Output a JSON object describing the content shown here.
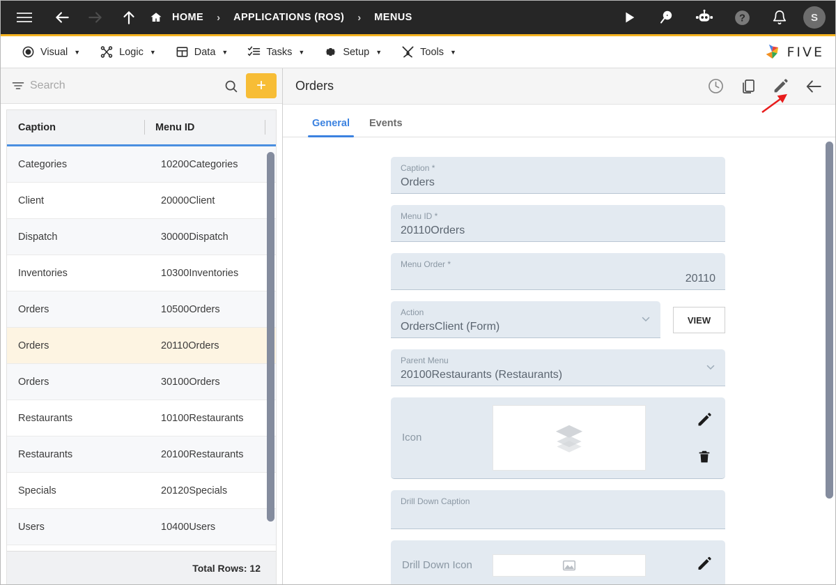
{
  "topbar": {
    "menu_icon": "hamburger-icon",
    "back_label": "back-arrow-icon",
    "forward_label": "forward-arrow-icon",
    "up_label": "up-arrow-icon",
    "breadcrumbs": [
      {
        "label": "HOME",
        "icon": "home-icon"
      },
      {
        "label": "APPLICATIONS (ROS)",
        "icon": ""
      },
      {
        "label": "MENUS",
        "icon": ""
      }
    ],
    "separator": "›",
    "actions": [
      {
        "name": "run-icon"
      },
      {
        "name": "search-play-icon"
      },
      {
        "name": "robot-icon"
      },
      {
        "name": "help-icon"
      },
      {
        "name": "notifications-bell-icon"
      }
    ],
    "avatar_initial": "S",
    "background": "#262626"
  },
  "menubar": {
    "accent_color": "#f5b421",
    "items": [
      {
        "label": "Visual",
        "icon": "eye-icon"
      },
      {
        "label": "Logic",
        "icon": "flow-icon"
      },
      {
        "label": "Data",
        "icon": "table-icon"
      },
      {
        "label": "Tasks",
        "icon": "checklist-icon"
      },
      {
        "label": "Setup",
        "icon": "gear-icon"
      },
      {
        "label": "Tools",
        "icon": "tools-icon"
      }
    ],
    "caret": "▼",
    "logo_text": "FIVE"
  },
  "sidebar": {
    "search": {
      "placeholder": "Search",
      "value": ""
    },
    "filter_icon": "filter-icon",
    "search_icon": "search-icon",
    "add_label": "+",
    "add_color": "#f7bd36",
    "columns": [
      "Caption",
      "Menu ID"
    ],
    "rows": [
      {
        "caption": "Categories",
        "menu_id": "10200Categories",
        "selected": false
      },
      {
        "caption": "Client",
        "menu_id": "20000Client",
        "selected": false
      },
      {
        "caption": "Dispatch",
        "menu_id": "30000Dispatch",
        "selected": false
      },
      {
        "caption": "Inventories",
        "menu_id": "10300Inventories",
        "selected": false
      },
      {
        "caption": "Orders",
        "menu_id": "10500Orders",
        "selected": false
      },
      {
        "caption": "Orders",
        "menu_id": "20110Orders",
        "selected": true
      },
      {
        "caption": "Orders",
        "menu_id": "30100Orders",
        "selected": false
      },
      {
        "caption": "Restaurants",
        "menu_id": "10100Restaurants",
        "selected": false
      },
      {
        "caption": "Restaurants",
        "menu_id": "20100Restaurants",
        "selected": false
      },
      {
        "caption": "Specials",
        "menu_id": "20120Specials",
        "selected": false
      },
      {
        "caption": "Users",
        "menu_id": "10400Users",
        "selected": false
      }
    ],
    "total_rows": "Total Rows: 12",
    "header_underline_color": "#4a8fe0",
    "selected_row_color": "#fdf4e2"
  },
  "detail": {
    "title": "Orders",
    "header_actions": [
      {
        "name": "history-clock-icon"
      },
      {
        "name": "copy-icon"
      },
      {
        "name": "edit-pencil-icon"
      },
      {
        "name": "back-arrow-icon"
      }
    ],
    "tabs": [
      {
        "label": "General",
        "active": true
      },
      {
        "label": "Events",
        "active": false
      }
    ],
    "active_tab_color": "#3b82e0",
    "fields": {
      "caption": {
        "label": "Caption *",
        "value": "Orders"
      },
      "menu_id": {
        "label": "Menu ID *",
        "value": "20110Orders"
      },
      "menu_order": {
        "label": "Menu Order *",
        "value": "20110"
      },
      "action": {
        "label": "Action",
        "value": "OrdersClient (Form)"
      },
      "parent_menu": {
        "label": "Parent Menu",
        "value": "20100Restaurants (Restaurants)"
      },
      "icon": {
        "label": "Icon",
        "value": "",
        "image_icon": "layers-icon"
      },
      "drill_down_caption": {
        "label": "Drill Down Caption",
        "value": ""
      },
      "drill_down_icon": {
        "label": "Drill Down Icon",
        "value": "",
        "image_icon": "image-placeholder-icon"
      }
    },
    "view_button": "VIEW",
    "field_bg": "#e3eaf1"
  },
  "annotation": {
    "arrow_color": "#e81c1c",
    "points_to": "edit-pencil-icon"
  }
}
